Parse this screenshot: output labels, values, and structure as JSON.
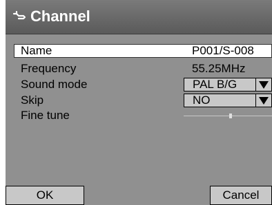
{
  "window": {
    "title": "Channel",
    "icon": "wrench-icon"
  },
  "fields": {
    "name": {
      "label": "Name",
      "value": "P001/S-008"
    },
    "frequency": {
      "label": "Frequency",
      "value": "55.25MHz"
    },
    "sound_mode": {
      "label": "Sound mode",
      "value": "PAL B/G"
    },
    "skip": {
      "label": "Skip",
      "value": "NO"
    },
    "fine_tune": {
      "label": "Fine tune",
      "level": 0.5
    }
  },
  "buttons": {
    "ok_label": "OK",
    "cancel_label": "Cancel"
  },
  "colors": {
    "panel_background": "#909090",
    "titlebar": "#6a6a6a",
    "highlight_row": "#ffffff",
    "control_fill": "#c8c8c8"
  }
}
